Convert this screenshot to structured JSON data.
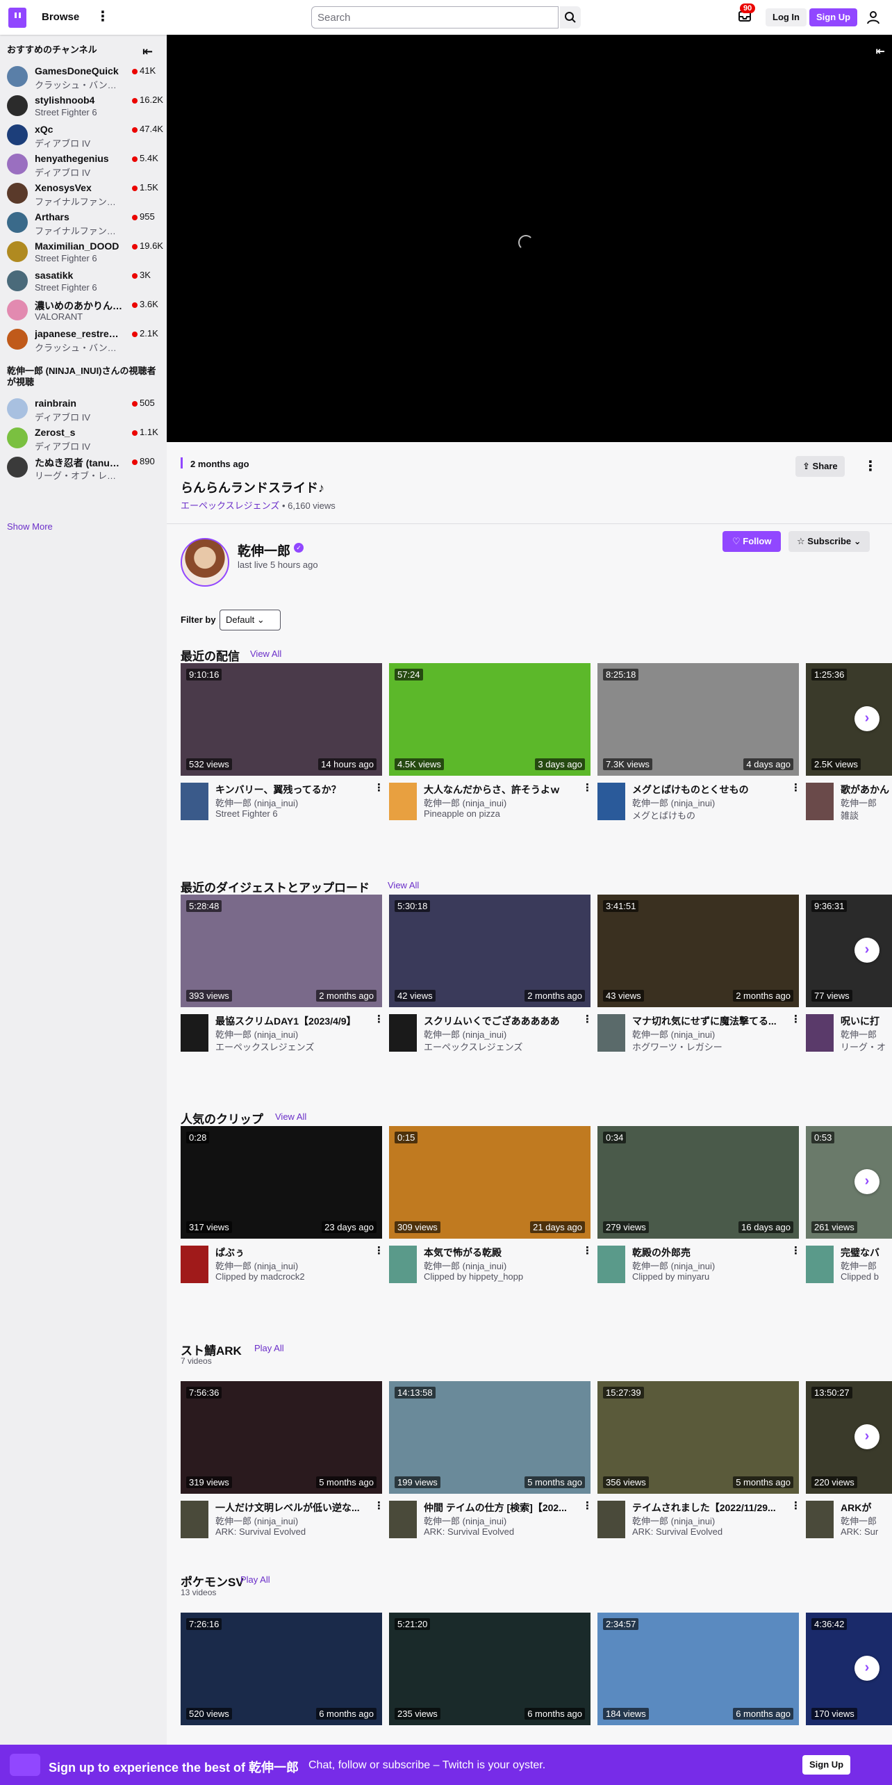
{
  "nav": {
    "browse": "Browse",
    "search_placeholder": "Search",
    "inbox_count": "90",
    "login": "Log In",
    "signup": "Sign Up"
  },
  "sidebar": {
    "rec_title": "おすすめのチャンネル",
    "channels": [
      {
        "name": "GamesDoneQuick",
        "game": "クラッシュ・バンデ...",
        "viewers": "41K",
        "color": "#5a7fa8"
      },
      {
        "name": "stylishnoob4",
        "game": "Street Fighter 6",
        "viewers": "16.2K",
        "color": "#2b2b2b"
      },
      {
        "name": "xQc",
        "game": "ディアブロ IV",
        "viewers": "47.4K",
        "color": "#1c3e7a"
      },
      {
        "name": "henyathegenius",
        "game": "ディアブロ IV",
        "viewers": "5.4K",
        "color": "#9a6fc0"
      },
      {
        "name": "XenosysVex",
        "game": "ファイナルファンタ...",
        "viewers": "1.5K",
        "color": "#5a3a2a"
      },
      {
        "name": "Arthars",
        "game": "ファイナルファンタ...",
        "viewers": "955",
        "color": "#3a6a8a"
      },
      {
        "name": "Maximilian_DOOD",
        "game": "Street Fighter 6",
        "viewers": "19.6K",
        "color": "#b08a20"
      },
      {
        "name": "sasatikk",
        "game": "Street Fighter 6",
        "viewers": "3K",
        "color": "#4a6a7a"
      },
      {
        "name": "濃いめのあかりん (...",
        "game": "VALORANT",
        "viewers": "3.6K",
        "color": "#e28ab0"
      },
      {
        "name": "japanese_restream",
        "game": "クラッシュ・バンデ...",
        "viewers": "2.1K",
        "color": "#c05a1a"
      }
    ],
    "viewers_title": "乾伸一郎 (NINJA_INUI)さんの視聴者が視聴",
    "viewer_channels": [
      {
        "name": "rainbrain",
        "game": "ディアブロ IV",
        "viewers": "505",
        "color": "#a8c0e0"
      },
      {
        "name": "Zerost_s",
        "game": "ディアブロ IV",
        "viewers": "1.1K",
        "color": "#7ac040"
      },
      {
        "name": "たぬき忍者 (tanuki...",
        "game": "リーグ・オブ・レジェ...",
        "viewers": "890",
        "color": "#3a3a3a"
      }
    ],
    "show_more": "Show More"
  },
  "video": {
    "ago": "2 months ago",
    "title": "らんらんランドスライド♪",
    "game": "エーペックスレジェンズ",
    "views": "6,160 views",
    "share": "Share"
  },
  "channel": {
    "name": "乾伸一郎",
    "last_live": "last live 5 hours ago",
    "follow": "Follow",
    "subscribe": "Subscribe"
  },
  "filter": {
    "label": "Filter by",
    "value": "Default"
  },
  "shelves": [
    {
      "title": "最近の配信",
      "link": "View All",
      "count": "",
      "cards": [
        {
          "dur": "9:10:16",
          "views": "532 views",
          "ago": "14 hours ago",
          "title": "キンバリー、翼残ってるか？",
          "ch": "乾伸一郎 (ninja_inui)",
          "sub": "Street Fighter 6",
          "bg": "#4a3a4a",
          "gc": "#3a5a8a"
        },
        {
          "dur": "57:24",
          "views": "4.5K views",
          "ago": "3 days ago",
          "title": "大人なんだからさ、許そうよｗ",
          "ch": "乾伸一郎 (ninja_inui)",
          "sub": "Pineapple on pizza",
          "bg": "#5cb82a",
          "gc": "#e8a040"
        },
        {
          "dur": "8:25:18",
          "views": "7.3K views",
          "ago": "4 days ago",
          "title": "メグとばけものとくせもの",
          "ch": "乾伸一郎 (ninja_inui)",
          "sub": "メグとばけもの",
          "bg": "#8a8a8a",
          "gc": "#2a5a9a"
        },
        {
          "dur": "1:25:36",
          "views": "2.5K views",
          "ago": "",
          "title": "歌があかん",
          "ch": "乾伸一郎",
          "sub": "雑談",
          "bg": "#3a3a2a",
          "gc": "#6a4a4a"
        }
      ]
    },
    {
      "title": "最近のダイジェストとアップロード",
      "link": "View All",
      "count": "",
      "cards": [
        {
          "dur": "5:28:48",
          "views": "393 views",
          "ago": "2 months ago",
          "title": "最協スクリムDAY1【2023/4/9】",
          "ch": "乾伸一郎 (ninja_inui)",
          "sub": "エーペックスレジェンズ",
          "bg": "#7a6a8a",
          "gc": "#1a1a1a"
        },
        {
          "dur": "5:30:18",
          "views": "42 views",
          "ago": "2 months ago",
          "title": "スクリムいくでござあああああ",
          "ch": "乾伸一郎 (ninja_inui)",
          "sub": "エーペックスレジェンズ",
          "bg": "#3a3a5a",
          "gc": "#1a1a1a"
        },
        {
          "dur": "3:41:51",
          "views": "43 views",
          "ago": "2 months ago",
          "title": "マナ切れ気にせずに魔法撃てる...",
          "ch": "乾伸一郎 (ninja_inui)",
          "sub": "ホグワーツ・レガシー",
          "bg": "#3a3020",
          "gc": "#5a6a6a"
        },
        {
          "dur": "9:36:31",
          "views": "77 views",
          "ago": "",
          "title": "呪いに打",
          "ch": "乾伸一郎",
          "sub": "リーグ・オ",
          "bg": "#2a2a2a",
          "gc": "#5a3a6a"
        }
      ]
    },
    {
      "title": "人気のクリップ",
      "link": "View All",
      "count": "",
      "cards": [
        {
          "dur": "0:28",
          "views": "317 views",
          "ago": "23 days ago",
          "title": "ぱぶぅ",
          "ch": "乾伸一郎 (ninja_inui)",
          "sub": "Clipped by madcrock2",
          "bg": "#111111",
          "gc": "#a01a1a"
        },
        {
          "dur": "0:15",
          "views": "309 views",
          "ago": "21 days ago",
          "title": "本気で怖がる乾殿",
          "ch": "乾伸一郎 (ninja_inui)",
          "sub": "Clipped by hippety_hopp",
          "bg": "#c07a20",
          "gc": "#5a9a8a"
        },
        {
          "dur": "0:34",
          "views": "279 views",
          "ago": "16 days ago",
          "title": "乾殿の外郎売",
          "ch": "乾伸一郎 (ninja_inui)",
          "sub": "Clipped by minyaru",
          "bg": "#4a5a4a",
          "gc": "#5a9a8a"
        },
        {
          "dur": "0:53",
          "views": "261 views",
          "ago": "",
          "title": "完璧なバ",
          "ch": "乾伸一郎",
          "sub": "Clipped b",
          "bg": "#6a7a6a",
          "gc": "#5a9a8a"
        }
      ]
    },
    {
      "title": "スト鯖ARK",
      "link": "Play All",
      "count": "7 videos",
      "cards": [
        {
          "dur": "7:56:36",
          "views": "319 views",
          "ago": "5 months ago",
          "title": "一人だけ文明レベルが低い逆な...",
          "ch": "乾伸一郎 (ninja_inui)",
          "sub": "ARK: Survival Evolved",
          "bg": "#2a1a1e",
          "gc": "#4a4a3a"
        },
        {
          "dur": "14:13:58",
          "views": "199 views",
          "ago": "5 months ago",
          "title": "仲間 テイムの仕方 [検索]【202...",
          "ch": "乾伸一郎 (ninja_inui)",
          "sub": "ARK: Survival Evolved",
          "bg": "#6a8a9a",
          "gc": "#4a4a3a"
        },
        {
          "dur": "15:27:39",
          "views": "356 views",
          "ago": "5 months ago",
          "title": "テイムされました【2022/11/29...",
          "ch": "乾伸一郎 (ninja_inui)",
          "sub": "ARK: Survival Evolved",
          "bg": "#5a5a3a",
          "gc": "#4a4a3a"
        },
        {
          "dur": "13:50:27",
          "views": "220 views",
          "ago": "",
          "title": "ARKが",
          "ch": "乾伸一郎",
          "sub": "ARK: Sur",
          "bg": "#3a3a2a",
          "gc": "#4a4a3a"
        }
      ]
    },
    {
      "title": "ポケモンSV",
      "link": "Play All",
      "count": "13 videos",
      "cards": [
        {
          "dur": "7:26:16",
          "views": "520 views",
          "ago": "6 months ago",
          "title": "",
          "ch": "",
          "sub": "",
          "bg": "#1a2a4a",
          "gc": "#333333"
        },
        {
          "dur": "5:21:20",
          "views": "235 views",
          "ago": "6 months ago",
          "title": "",
          "ch": "",
          "sub": "",
          "bg": "#1a2a2a",
          "gc": "#333333"
        },
        {
          "dur": "2:34:57",
          "views": "184 views",
          "ago": "6 months ago",
          "title": "",
          "ch": "",
          "sub": "",
          "bg": "#5a8ac0",
          "gc": "#333333"
        },
        {
          "dur": "4:36:42",
          "views": "170 views",
          "ago": "",
          "title": "",
          "ch": "",
          "sub": "",
          "bg": "#1a2a6a",
          "gc": "#333333"
        }
      ]
    }
  ],
  "banner": {
    "title": "Sign up to experience the best of 乾伸一郎",
    "sub": "Chat, follow or subscribe – Twitch is your oyster.",
    "signup": "Sign Up"
  }
}
